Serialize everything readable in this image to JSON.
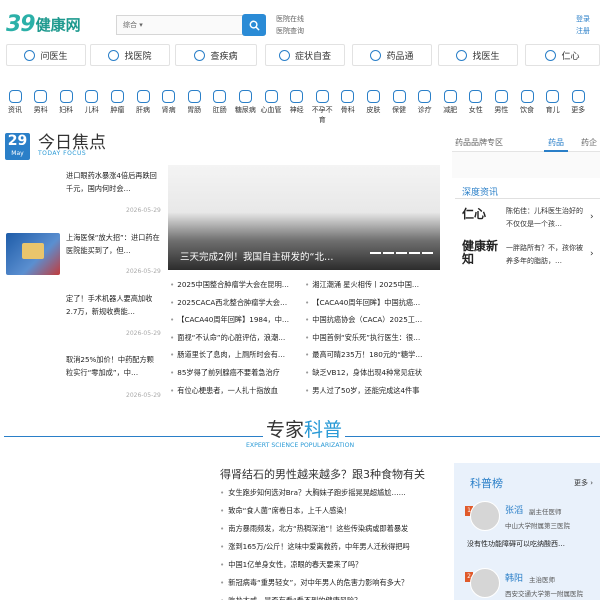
{
  "header": {
    "logo_mark": "39",
    "logo_text": "健康网",
    "search_category": "综合",
    "quick_links": [
      "医院在线",
      "医院查询"
    ],
    "user_links": [
      "登录",
      "注册"
    ]
  },
  "nav": [
    {
      "label": "问医生",
      "icon": "doctor-icon"
    },
    {
      "label": "找医院",
      "icon": "hospital-icon"
    },
    {
      "label": "查疾病",
      "icon": "disease-icon"
    },
    {
      "label": "症状自查",
      "icon": "symptom-icon"
    },
    {
      "label": "药品通",
      "icon": "pill-icon"
    },
    {
      "label": "找医生",
      "icon": "find-doctor-icon"
    },
    {
      "label": "仁心",
      "icon": "renxin-icon"
    }
  ],
  "categories": [
    "资讯",
    "男科",
    "妇科",
    "儿科",
    "肿瘤",
    "肝病",
    "肾病",
    "胃肠",
    "肛肠",
    "糖尿病",
    "心血管",
    "神经",
    "不孕不育",
    "骨科",
    "皮肤",
    "保健",
    "诊疗",
    "减肥",
    "女性",
    "男性",
    "饮食",
    "育儿",
    "更多"
  ],
  "focus": {
    "day": "29",
    "month": "May",
    "title": "今日焦点",
    "subtitle": "TODAY FOCUS",
    "news": [
      {
        "text": "进口眼药水暴涨4倍后再跌回千元，国内何时会…",
        "date": "2026-05-29"
      },
      {
        "text": "上海医保“放大招”：进口药在医院能买到了，但…",
        "date": "2026-05-29"
      },
      {
        "text": "定了！手术机器人要高加收2.7万，新规收费能…",
        "date": "2026-05-29"
      },
      {
        "text": "取消25%加价！中药配方颗粒实行“零加成”，中…",
        "date": "2026-05-29"
      }
    ]
  },
  "banner": {
    "caption": "三天完成2例！我国自主研发的“北…"
  },
  "mid_links": [
    [
      "2025中国整合肿瘤学大会在昆明…",
      "湘江潮涌 星火相传丨2025中国…"
    ],
    [
      "2025CACA西北整合肿瘤学大会…",
      "【CACA40周年回眸】中国抗癌…"
    ],
    [
      "【CACA40周年回眸】1984，中…",
      "中国抗癌协会（CACA）2025工…"
    ],
    [
      "面视“不认命”的心脏评估，浪潮…",
      "中国首例“安乐死”执行医生：很…"
    ],
    [
      "肠道里长了息肉，上厕所时会有…",
      "最高可睛235万！180元的“糖学…"
    ],
    [
      "85岁得了前列腺癌不要着急治疗",
      "缺乏VB12，身体出现4种常见症状"
    ],
    [
      "有位心梗患者，一人扎十指放血",
      "男人过了50岁，还能完成这4件事"
    ]
  ],
  "right": {
    "tab1": "药品品牌专区",
    "tab2": "药品",
    "tab3": "药企",
    "depth_title": "深度资讯",
    "depth": [
      {
        "logo": "仁心",
        "text": "陈佑佳：儿科医生治好的不仅仅是一个孩…"
      },
      {
        "logo": "健康新知",
        "text": "一胖路所有？不，孩你被养多年的脂肪，…"
      }
    ]
  },
  "expert": {
    "title_a": "专家",
    "title_b": "科普",
    "subtitle": "EXPERT SCIENCE POPULARIZATION",
    "headline": "得肾结石的男性越来越多？跟3种食物有关",
    "items": [
      "女生跑步知何选对Bra？大胸妹子跑步摇晃晃超尴尬……",
      "致命“食人菌”席卷日本，上千人感染！",
      "南方暴雨频发，北方“热稠深池”！这些传染病或即着暴发",
      "涨到165万/公斤！这味中爱离救药，中年男人迁秋得把吗",
      "中国1亿单身女性，凉眼的春天要来了吗？",
      "新冠病毒“重男轻女”，对中年男人的危害力影响有多大？",
      "吃盐太咸，是否有看“看不到的健康风险？"
    ]
  },
  "kepu": {
    "title": "科普榜",
    "more": "更多",
    "people": [
      {
        "rank": "1",
        "name": "张滔",
        "role": "副主任医师",
        "hospital": "中山大学附属第三医院",
        "desc": "没有性功能障碍可以吃纳酸西…"
      },
      {
        "rank": "2",
        "name": "韩阳",
        "role": "主治医师",
        "hospital": "西安交通大学第一附属医院",
        "desc": ""
      }
    ]
  }
}
